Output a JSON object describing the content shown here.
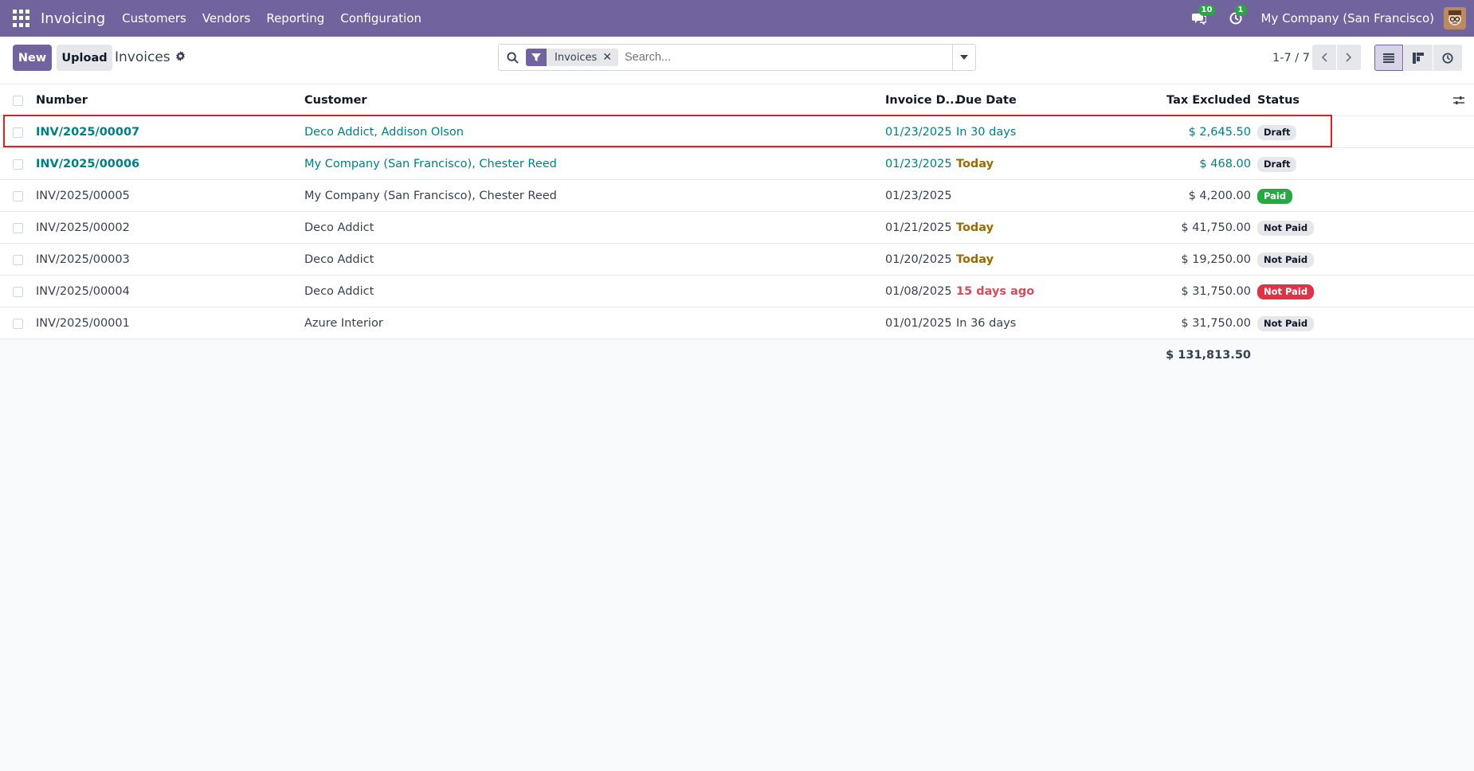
{
  "navbar": {
    "brand": "Invoicing",
    "menu": [
      "Customers",
      "Vendors",
      "Reporting",
      "Configuration"
    ],
    "messages_count": "10",
    "activities_count": "1",
    "company": "My Company (San Francisco)"
  },
  "control": {
    "new_label": "New",
    "upload_label": "Upload",
    "title": "Invoices",
    "facet_label": "Invoices",
    "search_placeholder": "Search...",
    "pager": "1-7 / 7"
  },
  "table": {
    "headers": {
      "number": "Number",
      "customer": "Customer",
      "invoice_date": "Invoice D...",
      "due_date": "Due Date",
      "tax_excluded": "Tax Excluded",
      "status": "Status"
    },
    "rows": [
      {
        "number": "INV/2025/00007",
        "customer": "Deco Addict, Addison Olson",
        "invoice_date": "01/23/2025",
        "due_date": "In 30 days",
        "tax_excluded": "$ 2,645.50",
        "status": "Draft"
      },
      {
        "number": "INV/2025/00006",
        "customer": "My Company (San Francisco), Chester Reed",
        "invoice_date": "01/23/2025",
        "due_date": "Today",
        "tax_excluded": "$ 468.00",
        "status": "Draft"
      },
      {
        "number": "INV/2025/00005",
        "customer": "My Company (San Francisco), Chester Reed",
        "invoice_date": "01/23/2025",
        "due_date": "",
        "tax_excluded": "$ 4,200.00",
        "status": "Paid"
      },
      {
        "number": "INV/2025/00002",
        "customer": "Deco Addict",
        "invoice_date": "01/21/2025",
        "due_date": "Today",
        "tax_excluded": "$ 41,750.00",
        "status": "Not Paid"
      },
      {
        "number": "INV/2025/00003",
        "customer": "Deco Addict",
        "invoice_date": "01/20/2025",
        "due_date": "Today",
        "tax_excluded": "$ 19,250.00",
        "status": "Not Paid"
      },
      {
        "number": "INV/2025/00004",
        "customer": "Deco Addict",
        "invoice_date": "01/08/2025",
        "due_date": "15 days ago",
        "tax_excluded": "$ 31,750.00",
        "status": "Not Paid"
      },
      {
        "number": "INV/2025/00001",
        "customer": "Azure Interior",
        "invoice_date": "01/01/2025",
        "due_date": "In 36 days",
        "tax_excluded": "$ 31,750.00",
        "status": "Not Paid"
      }
    ],
    "total": "$ 131,813.50"
  },
  "colors": {
    "brand": "#71639e",
    "link": "#017e84",
    "warning": "#9a6b00",
    "danger": "#dc3545",
    "success": "#28a745",
    "highlight": "#e02020"
  }
}
